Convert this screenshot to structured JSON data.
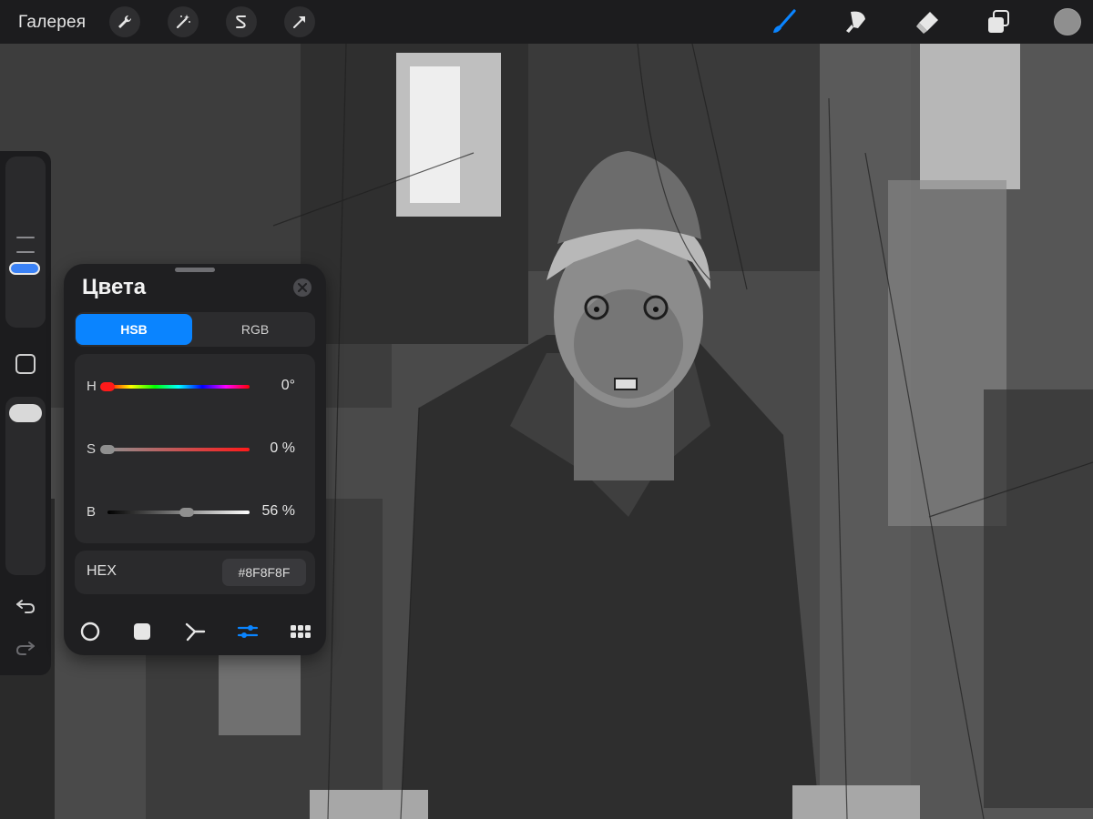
{
  "toolbar": {
    "gallery_label": "Галерея",
    "left_tools": [
      "wrench-icon",
      "magic-wand-icon",
      "selection-s-icon",
      "transform-arrow-icon"
    ],
    "right_tools": [
      "brush-icon",
      "smudge-icon",
      "eraser-icon",
      "layers-icon"
    ],
    "active_tool": "brush-icon",
    "current_color": "#8F8F8F"
  },
  "sidebar": {
    "brush_size_level": 0.8,
    "opacity_level": 0.95,
    "undo_icon": "undo-arrow-icon",
    "redo_icon": "redo-arrow-icon"
  },
  "colors_panel": {
    "title": "Цвета",
    "tabs": [
      {
        "label": "HSB",
        "active": true
      },
      {
        "label": "RGB",
        "active": false
      }
    ],
    "sliders": [
      {
        "label": "H",
        "value_text": "0°",
        "fraction": 0.0
      },
      {
        "label": "S",
        "value_text": "0 %",
        "fraction": 0.0
      },
      {
        "label": "B",
        "value_text": "56 %",
        "fraction": 0.56
      }
    ],
    "hex_label": "HEX",
    "hex_value": "#8F8F8F",
    "modes": [
      "disc-mode-icon",
      "classic-mode-icon",
      "harmony-mode-icon",
      "values-mode-icon",
      "palettes-mode-icon"
    ],
    "active_mode": "values-mode-icon",
    "accent_color": "#0A84FF"
  }
}
